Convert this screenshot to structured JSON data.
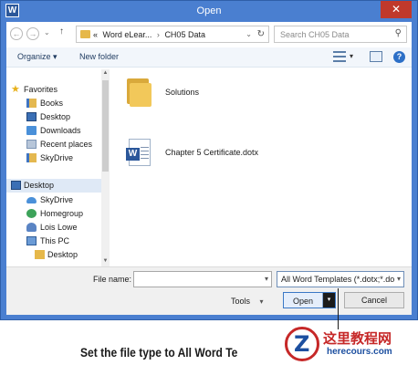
{
  "window": {
    "title": "Open",
    "app_icon_letter": "W",
    "close_glyph": "✕"
  },
  "address_bar": {
    "back_glyph": "←",
    "forward_glyph": "→",
    "recent_glyph": "⌄",
    "up_glyph": "↑",
    "overflow": "«",
    "crumbs": [
      "Word eLear...",
      "CH05 Data"
    ],
    "separator": "›",
    "dropdown_glyph": "⌄",
    "refresh_glyph": "↻"
  },
  "search": {
    "placeholder": "Search CH05 Data",
    "icon": "search-icon"
  },
  "toolbar": {
    "organize_label": "Organize ▾",
    "new_folder_label": "New folder",
    "help_label": "?"
  },
  "nav": {
    "items": [
      {
        "label": "Favorites",
        "icon": "star-icon"
      },
      {
        "label": "Books",
        "icon": "library-icon"
      },
      {
        "label": "Desktop",
        "icon": "desktop-icon"
      },
      {
        "label": "Downloads",
        "icon": "downloads-icon"
      },
      {
        "label": "Recent places",
        "icon": "recent-places-icon"
      },
      {
        "label": "SkyDrive",
        "icon": "library-icon"
      },
      {
        "label": "Desktop",
        "icon": "desktop-icon"
      },
      {
        "label": "SkyDrive",
        "icon": "cloud-icon"
      },
      {
        "label": "Homegroup",
        "icon": "homegroup-icon"
      },
      {
        "label": "Lois Lowe",
        "icon": "user-icon"
      },
      {
        "label": "This PC",
        "icon": "computer-icon"
      },
      {
        "label": "Desktop",
        "icon": "folder-icon"
      }
    ]
  },
  "files": [
    {
      "name": "Solutions",
      "type": "folder"
    },
    {
      "name": "Chapter 5 Certificate.dotx",
      "type": "word-template"
    }
  ],
  "bottom": {
    "file_name_label": "File name:",
    "file_name_value": "",
    "file_type_value": "All Word Templates (*.dotx;*.do",
    "tools_label": "Tools",
    "open_label": "Open",
    "cancel_label": "Cancel",
    "dropdown_glyph": "▾"
  },
  "caption": "Set the file type to All Word Te",
  "watermark": {
    "title": "这里教程网",
    "url": "herecours.com",
    "logo_letter": "Z"
  },
  "colors": {
    "title_bar": "#4a7fd0",
    "close_button": "#c0392b",
    "selection": "#dfe9f6",
    "word_blue": "#2b579a"
  }
}
